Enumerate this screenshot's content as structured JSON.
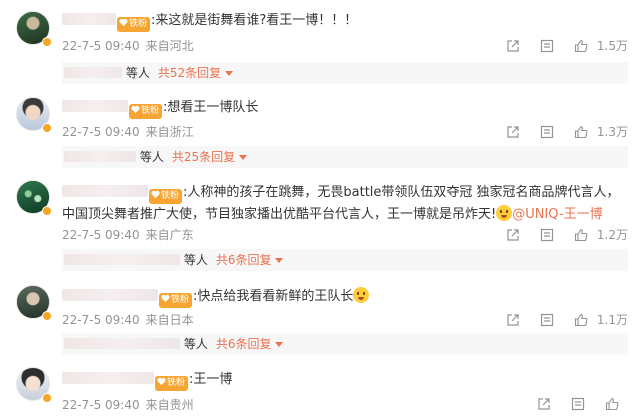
{
  "comments": [
    {
      "text": ":来这就是街舞看谁?看王一博！！！",
      "date": "22-7-5 09:40",
      "location": "来自河北",
      "likes": "1.5万",
      "reply_suffix": "等人",
      "reply_total": "共52条回复",
      "avatar_color": "#2d4a2f",
      "badge_color": "#f5a623"
    },
    {
      "text": ":想看王一博队长",
      "date": "22-7-5 09:40",
      "location": "来自浙江",
      "likes": "1.3万",
      "reply_suffix": "等人",
      "reply_total": "共25条回复",
      "avatar_color": "#cfd8e6",
      "badge_color": "#f5a623"
    },
    {
      "text": ":人称神的孩子在跳舞，无畏battle带领队伍双夺冠 独家冠名商品牌代言人，中国顶尖舞者推广大使，节目独家播出优酷平台代言人，王一博就是吊炸天!",
      "mention": "@UNIQ-王一博",
      "date": "22-7-5 09:40",
      "location": "来自广东",
      "likes": "1.2万",
      "reply_suffix": "等人",
      "reply_total": "共6条回复",
      "avatar_color": "#1f5a3c",
      "badge_color": "#f5a623"
    },
    {
      "text": ":快点给我看看新鲜的王队长",
      "date": "22-7-5 09:40",
      "location": "来自日本",
      "likes": "1.1万",
      "reply_suffix": "等人",
      "reply_total": "共6条回复",
      "avatar_color": "#3b4a3f",
      "badge_color": "#f5a623"
    },
    {
      "text": ":王一博",
      "date": "22-7-5 09:40",
      "location": "来自贵州",
      "likes": "",
      "avatar_color": "#dfe3ea",
      "badge_color": "#f5a623"
    }
  ],
  "fan_badge_label": "铁粉",
  "colors": {
    "accent": "#eb7350",
    "meta": "#939393",
    "reply_bg": "#f7f7f7",
    "fan_badge": "#f7a532"
  },
  "icons": [
    "share-icon",
    "comment-icon",
    "like-icon",
    "reply-caret-icon",
    "heart-badge-icon",
    "verified-badge-icon",
    "emoji-icon"
  ]
}
